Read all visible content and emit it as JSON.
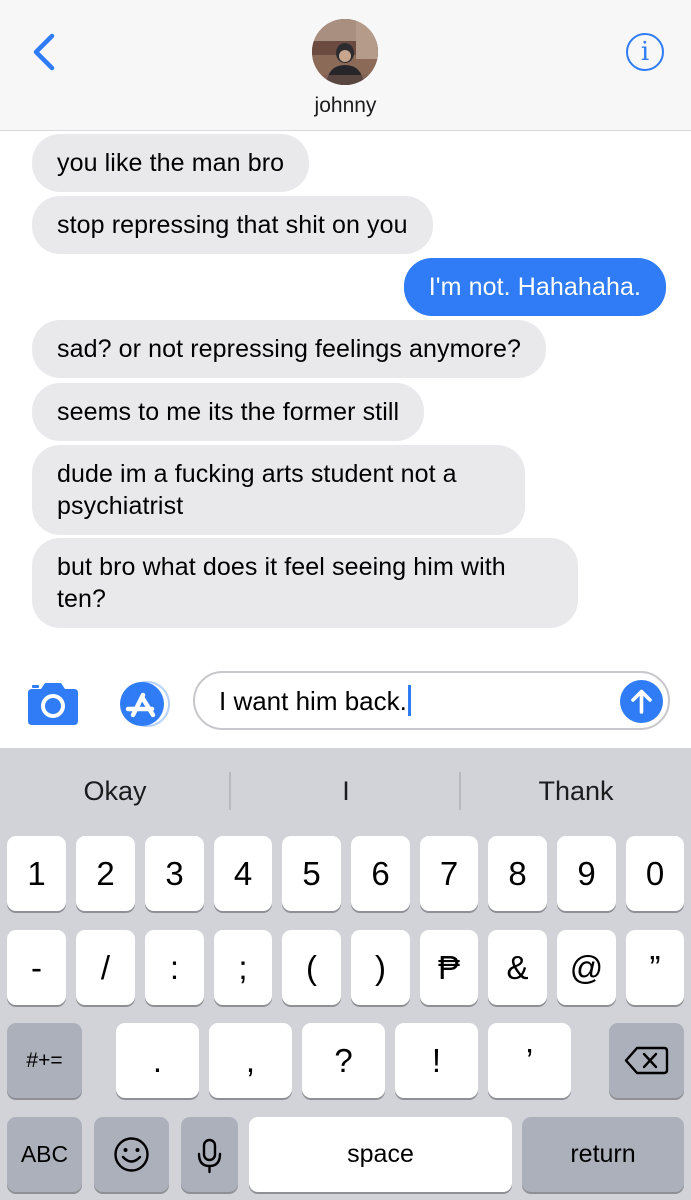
{
  "header": {
    "contact_name": "johnny",
    "back_icon": "chevron-left-icon",
    "info_icon": "info-icon",
    "info_glyph": "i"
  },
  "messages": [
    {
      "direction": "received",
      "text": "you like the man bro"
    },
    {
      "direction": "received",
      "text": "stop repressing that shit on you"
    },
    {
      "direction": "sent",
      "text": "I'm not. Hahahaha."
    },
    {
      "direction": "received",
      "text": "sad? or not repressing feelings anymore?"
    },
    {
      "direction": "received",
      "text": "seems to me its the former still"
    },
    {
      "direction": "received",
      "text": "dude im a fucking arts student not a psychiatrist"
    },
    {
      "direction": "received",
      "text": "but bro what does it feel seeing him with ten?"
    }
  ],
  "composer": {
    "text": "I want him back.",
    "camera_icon": "camera-icon",
    "apps_icon": "app-store-icon",
    "send_icon": "send-arrow-icon"
  },
  "keyboard": {
    "suggestions": [
      "Okay",
      "I",
      "Thank"
    ],
    "row1": [
      "1",
      "2",
      "3",
      "4",
      "5",
      "6",
      "7",
      "8",
      "9",
      "0"
    ],
    "row2": [
      "-",
      "/",
      ":",
      ";",
      "(",
      ")",
      "₱",
      "&",
      "@",
      "”"
    ],
    "row3": {
      "shift": "#+=",
      "keys": [
        ".",
        ",",
        "?",
        "!",
        "’"
      ],
      "delete_icon": "backspace-icon"
    },
    "row4": {
      "abc": "ABC",
      "emoji_icon": "emoji-icon",
      "mic_icon": "microphone-icon",
      "space": "space",
      "return": "return"
    }
  }
}
